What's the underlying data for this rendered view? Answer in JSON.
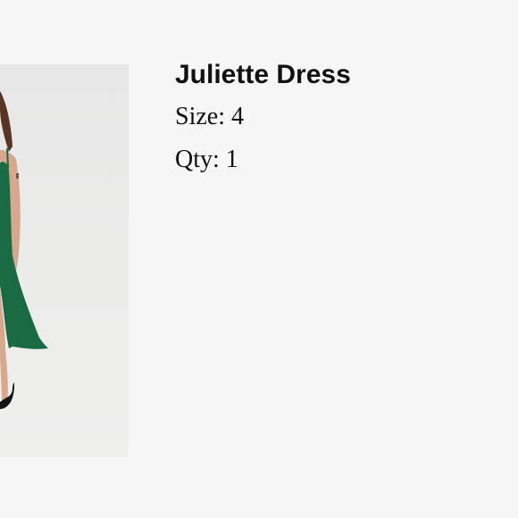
{
  "product": {
    "title": "Juliette Dress",
    "size_label": "Size:",
    "size_value": "4",
    "qty_label": "Qty:",
    "qty_value": "1"
  },
  "photo": {
    "dress_color": "#1a6b43",
    "background_color": "#ebebea"
  }
}
